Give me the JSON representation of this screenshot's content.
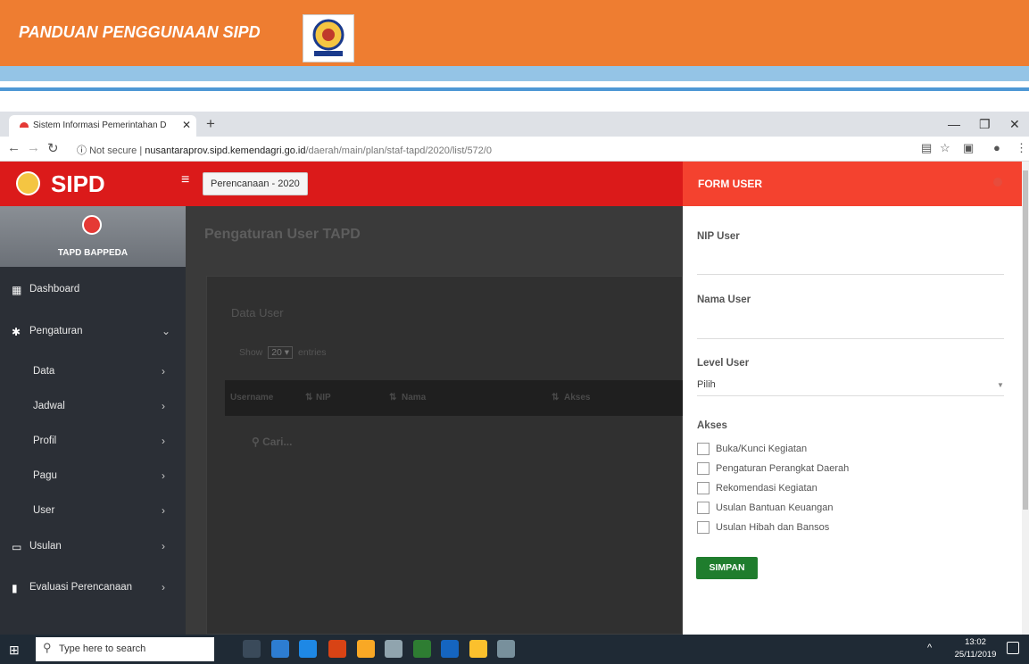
{
  "document": {
    "title": "PANDUAN PENGGUNAAN SIPD"
  },
  "browser": {
    "tab_title": "Sistem Informasi Pemerintahan D",
    "security": "Not secure",
    "url_host": "nusantaraprov.sipd.kemendagri.go.id",
    "url_path": "/daerah/main/plan/staf-tapd/2020/list/572/0"
  },
  "app": {
    "brand": "SIPD",
    "period_badge": "Perencanaan - 2020",
    "user_role": "TAPD BAPPEDA",
    "sidebar": [
      {
        "label": "Dashboard",
        "icon": "dashboard-icon"
      },
      {
        "label": "Pengaturan",
        "icon": "gear-icon"
      },
      {
        "label": "Data",
        "icon": ""
      },
      {
        "label": "Jadwal",
        "icon": ""
      },
      {
        "label": "Profil",
        "icon": ""
      },
      {
        "label": "Pagu",
        "icon": ""
      },
      {
        "label": "User",
        "icon": ""
      },
      {
        "label": "Usulan",
        "icon": "monitor-icon"
      },
      {
        "label": "Evaluasi Perencanaan",
        "icon": "bookmark-icon"
      }
    ],
    "page_title": "Pengaturan User TAPD",
    "panel_tab": "Data User",
    "show_label": "Show",
    "entries_value": "20",
    "entries_label": "entries",
    "table_headers": [
      "Username",
      "NIP",
      "Nama",
      "Akses"
    ],
    "search_placeholder": "Cari..."
  },
  "form": {
    "title": "FORM USER",
    "nip_label": "NIP User",
    "nama_label": "Nama User",
    "level_label": "Level User",
    "level_value": "Pilih",
    "akses_label": "Akses",
    "akses_options": [
      "Buka/Kunci Kegiatan",
      "Pengaturan Perangkat Daerah",
      "Rekomendasi Kegiatan",
      "Usulan Bantuan Keuangan",
      "Usulan Hibah dan Bansos"
    ],
    "submit_label": "SIMPAN"
  },
  "taskbar": {
    "search_placeholder": "Type here to search",
    "time": "13:02",
    "date": "25/11/2019"
  },
  "colors": {
    "header_orange": "#ee7d31",
    "navbar_red": "#db1a1a",
    "form_header_red": "#f4422f",
    "save_green": "#1f7d2d"
  }
}
